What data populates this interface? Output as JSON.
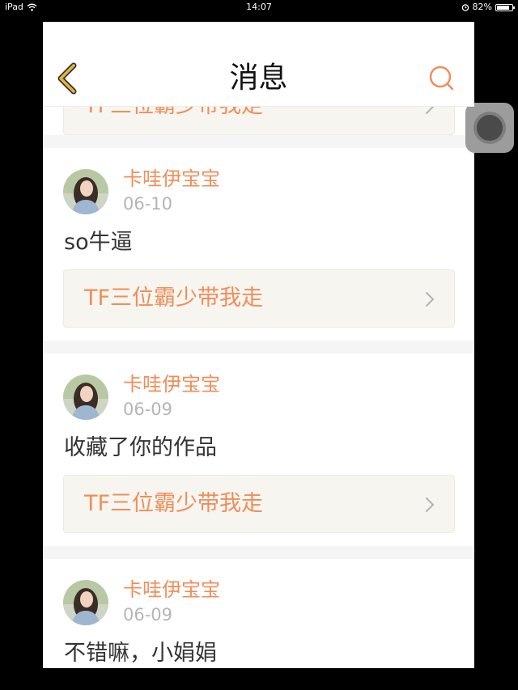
{
  "status_bar": {
    "device": "iPad",
    "time": "14:07",
    "battery_percent": "82%",
    "battery_level": 0.82
  },
  "nav": {
    "title": "消息",
    "back_icon": "back-chevron-icon",
    "search_icon": "search-icon"
  },
  "colors": {
    "accent": "#ef8e5b",
    "back_icon": "#e3b63a",
    "date": "#b5b5b5",
    "text": "#333333",
    "work_bg": "#f6f5ef"
  },
  "partial_top_card": {
    "work_title": "TF三位霸少带我走"
  },
  "messages": [
    {
      "user": "卡哇伊宝宝",
      "date": "06-10",
      "text": "so牛逼",
      "work_title": "TF三位霸少带我走"
    },
    {
      "user": "卡哇伊宝宝",
      "date": "06-09",
      "text": "收藏了你的作品",
      "work_title": "TF三位霸少带我走"
    },
    {
      "user": "卡哇伊宝宝",
      "date": "06-09",
      "text": "不错嘛，小娟娟"
    }
  ]
}
